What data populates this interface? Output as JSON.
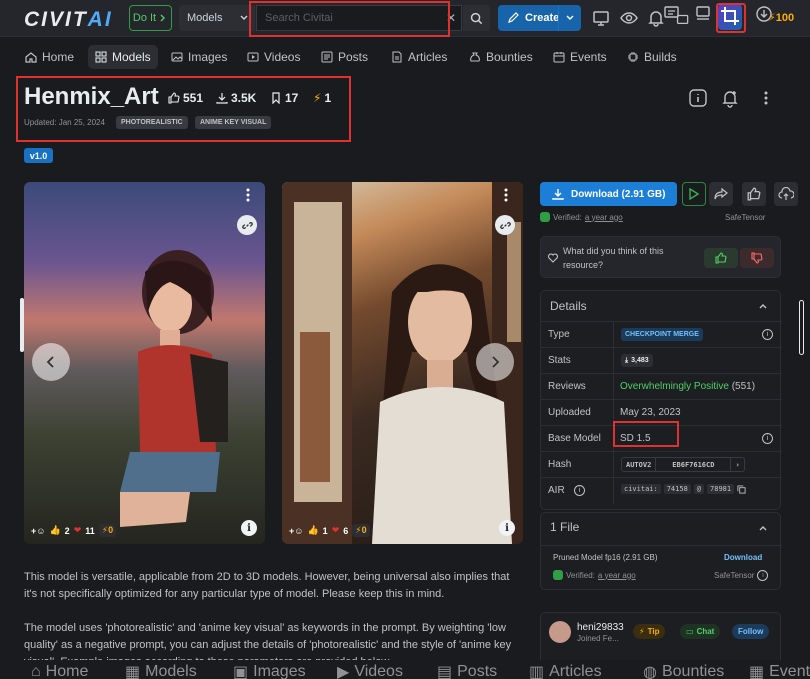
{
  "header": {
    "logo": "CIVIT",
    "logo_accent": "AI",
    "doit_label": "Do It",
    "model_select": "Models",
    "search_placeholder": "Search Civitai",
    "create_label": "Create",
    "buzz": "100"
  },
  "nav": [
    {
      "label": "Home",
      "icon": "home-icon"
    },
    {
      "label": "Models",
      "icon": "grid-icon"
    },
    {
      "label": "Images",
      "icon": "photo-icon"
    },
    {
      "label": "Videos",
      "icon": "video-icon"
    },
    {
      "label": "Posts",
      "icon": "posts-icon"
    },
    {
      "label": "Articles",
      "icon": "article-icon"
    },
    {
      "label": "Bounties",
      "icon": "moneybag-icon"
    },
    {
      "label": "Events",
      "icon": "calendar-icon"
    },
    {
      "label": "Builds",
      "icon": "cpu-icon"
    }
  ],
  "model": {
    "title": "Henmix_Art",
    "likes": "551",
    "downloads": "3.5K",
    "bookmarks": "17",
    "buzz": "1",
    "updated": "Updated: Jan 25, 2024",
    "tags": [
      "PHOTOREALISTIC",
      "ANIME KEY VISUAL"
    ],
    "version": "v1.0"
  },
  "images": [
    {
      "r1": "2",
      "r2": "11",
      "r3": "0"
    },
    {
      "r1": "1",
      "r2": "6",
      "r3": "0"
    }
  ],
  "description": [
    "This model is versatile, applicable from 2D to 3D models. However, being universal also implies that it's not specifically optimized for any particular type of model. Please keep this in mind.",
    "The model uses 'photorealistic' and 'anime key visual' as keywords in the prompt. By weighting 'low quality' as a negative prompt, you can adjust the details of 'photorealistic' and the style of 'anime key visual'. Example images according to these parameters are provided below."
  ],
  "sidebar": {
    "download_label": "Download (2.91 GB)",
    "verified": "Verified:",
    "verified_when": "a year ago",
    "safetensor": "SafeTensor",
    "feedback_q": "What did you think of this resource?",
    "details_title": "Details",
    "rows": {
      "type_k": "Type",
      "type_v": "CHECKPOINT MERGE",
      "stats_k": "Stats",
      "stats_v": "3,483",
      "reviews_k": "Reviews",
      "reviews_v": "Overwhelmingly Positive",
      "reviews_n": "(551)",
      "uploaded_k": "Uploaded",
      "uploaded_v": "May 23, 2023",
      "base_k": "Base Model",
      "base_v": "SD 1.5",
      "hash_k": "Hash",
      "hash_algo": "AUTOV2",
      "hash_v": "EB6F7616CD",
      "air_k": "AIR",
      "air_prefix": "civitai:",
      "air_a": "74158",
      "air_at": "@",
      "air_b": "78981"
    },
    "files_title": "1 File",
    "file_name": "Pruned Model fp16 (2.91 GB)",
    "file_download": "Download",
    "creator_name": "heni29833",
    "creator_joined": "Joined Fe...",
    "tip": "Tip",
    "chat": "Chat",
    "follow": "Follow"
  },
  "colors": {
    "accent": "#1c7ed6",
    "highlight": "#e03131",
    "positive": "#51cf66"
  }
}
